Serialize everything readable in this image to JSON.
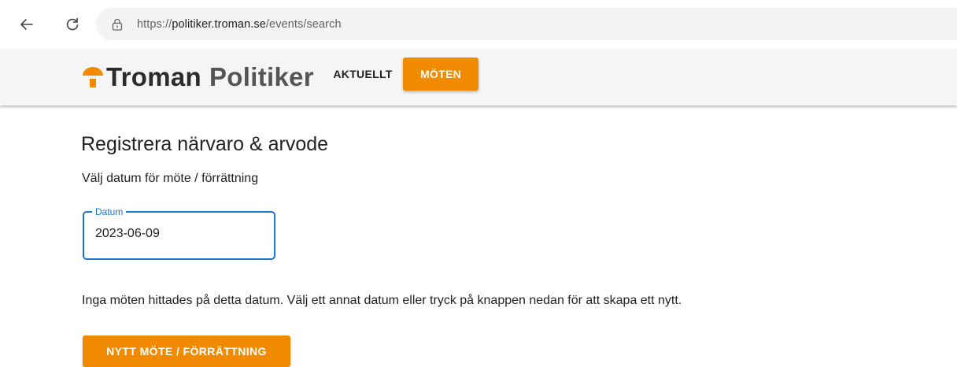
{
  "browser": {
    "url_scheme": "https://",
    "url_host": "politiker.troman.se",
    "url_path": "/events/search",
    "back_icon": "arrow-left-icon",
    "reload_icon": "reload-icon",
    "site_info_icon": "site-info-icon"
  },
  "header": {
    "brand_name": "Troman",
    "brand_sub": "Politiker",
    "nav": {
      "aktuellt": "AKTUELLT",
      "moten": "MÖTEN"
    }
  },
  "main": {
    "title": "Registrera närvaro & arvode",
    "subtitle": "Välj datum för möte / förrättning",
    "date_field": {
      "label": "Datum",
      "value": "2023-06-09"
    },
    "message": "Inga möten hittades på detta datum. Välj ett annat datum eller tryck på knappen nedan för att skapa ett nytt.",
    "create_button": "NYTT MÖTE / FÖRRÄTTNING"
  },
  "colors": {
    "accent": "#f28a00",
    "focus": "#1976d2",
    "header_bg": "#f5f5f5",
    "text": "#222222"
  }
}
